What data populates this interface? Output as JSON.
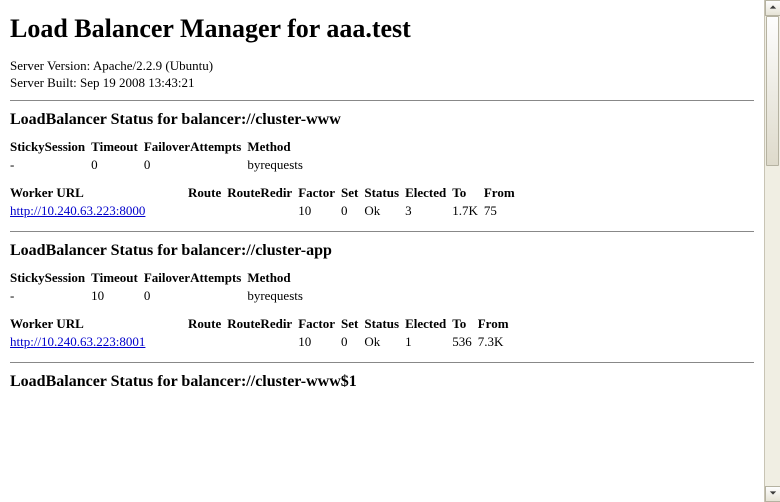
{
  "page_title": "Load Balancer Manager for aaa.test",
  "server_version_label": "Server Version:",
  "server_version": "Apache/2.2.9 (Ubuntu)",
  "server_built_label": "Server Built:",
  "server_built": "Sep 19 2008 13:43:21",
  "settings_headers": {
    "sticky": "StickySession",
    "timeout": "Timeout",
    "failover": "FailoverAttempts",
    "method": "Method"
  },
  "worker_headers": {
    "url": "Worker URL",
    "route": "Route",
    "route_redir": "RouteRedir",
    "factor": "Factor",
    "set": "Set",
    "status": "Status",
    "elected": "Elected",
    "to": "To",
    "from": "From"
  },
  "balancers": [
    {
      "title": "LoadBalancer Status for balancer://cluster-www",
      "settings": {
        "sticky": "-",
        "timeout": "0",
        "failover": "0",
        "method": "byrequests"
      },
      "worker": {
        "url": "http://10.240.63.223:8000",
        "route": "",
        "route_redir": "",
        "factor": "10",
        "set": "0",
        "status": "Ok",
        "elected": "3",
        "to": "1.7K",
        "from": "75"
      }
    },
    {
      "title": "LoadBalancer Status for balancer://cluster-app",
      "settings": {
        "sticky": "-",
        "timeout": "10",
        "failover": "0",
        "method": "byrequests"
      },
      "worker": {
        "url": "http://10.240.63.223:8001",
        "route": "",
        "route_redir": "",
        "factor": "10",
        "set": "0",
        "status": "Ok",
        "elected": "1",
        "to": "536",
        "from": "7.3K"
      }
    },
    {
      "title": "LoadBalancer Status for balancer://cluster-www$1"
    }
  ]
}
